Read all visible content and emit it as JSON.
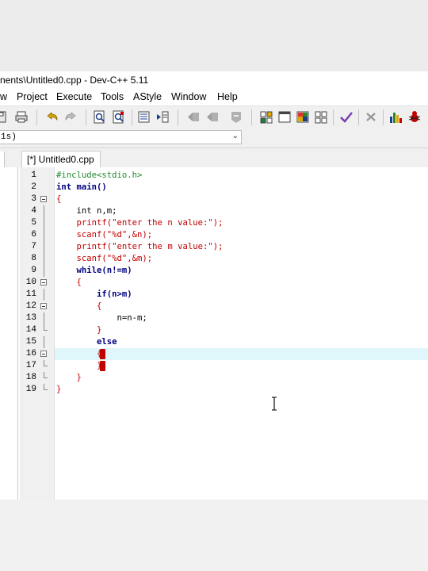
{
  "window": {
    "title": "nents\\Untitled0.cpp - Dev-C++ 5.11"
  },
  "menu": [
    "w",
    "Project",
    "Execute",
    "Tools",
    "AStyle",
    "Window",
    "Help"
  ],
  "combo": {
    "value": "1s)",
    "arrow": "⌄"
  },
  "tabs": [
    {
      "label": "[*] Untitled0.cpp"
    }
  ],
  "editor": {
    "lines": [
      {
        "n": "1",
        "text": "#include<stdio.h>",
        "kind": "pre"
      },
      {
        "n": "2",
        "text": "int main()",
        "kind": "kw"
      },
      {
        "n": "3",
        "text": "{",
        "kind": "brace"
      },
      {
        "n": "4",
        "text": "    int n,m;",
        "kind": "norm"
      },
      {
        "n": "5",
        "text": "    printf(\"enter the n value:\");",
        "kind": "str"
      },
      {
        "n": "6",
        "text": "    scanf(\"%d\",&n);",
        "kind": "str"
      },
      {
        "n": "7",
        "text": "    printf(\"enter the m value:\");",
        "kind": "str"
      },
      {
        "n": "8",
        "text": "    scanf(\"%d\",&m);",
        "kind": "str"
      },
      {
        "n": "9",
        "text": "    while(n!=m)",
        "kind": "kw"
      },
      {
        "n": "10",
        "text": "    {",
        "kind": "brace"
      },
      {
        "n": "11",
        "text": "        if(n>m)",
        "kind": "kw"
      },
      {
        "n": "12",
        "text": "        {",
        "kind": "brace"
      },
      {
        "n": "13",
        "text": "            n=n-m;",
        "kind": "norm"
      },
      {
        "n": "14",
        "text": "        }",
        "kind": "brace"
      },
      {
        "n": "15",
        "text": "        else",
        "kind": "kw"
      },
      {
        "n": "16",
        "text": "        {",
        "kind": "brace"
      },
      {
        "n": "17",
        "text": "        }",
        "kind": "brace"
      },
      {
        "n": "18",
        "text": "    }",
        "kind": "brace"
      },
      {
        "n": "19",
        "text": "}",
        "kind": "brace"
      }
    ],
    "active_line": 16
  },
  "colors": {
    "preprocessor": "#1f8a2c",
    "keyword": "#000080",
    "brace": "#c00000",
    "string": "#c00000",
    "active_line_bg": "#dff6fb"
  },
  "toolbar_icons": [
    "save-all-icon",
    "print-icon",
    "undo-icon",
    "redo-icon",
    "find-icon",
    "replace-icon",
    "indent-icon",
    "unindent-icon",
    "bookmark-prev-icon",
    "bookmark-next-icon",
    "bookmark-toggle-icon",
    "new-project-icon",
    "window-icon",
    "layout-icon",
    "grid-icon",
    "check-icon",
    "close-icon",
    "chart-icon",
    "debug-icon"
  ]
}
